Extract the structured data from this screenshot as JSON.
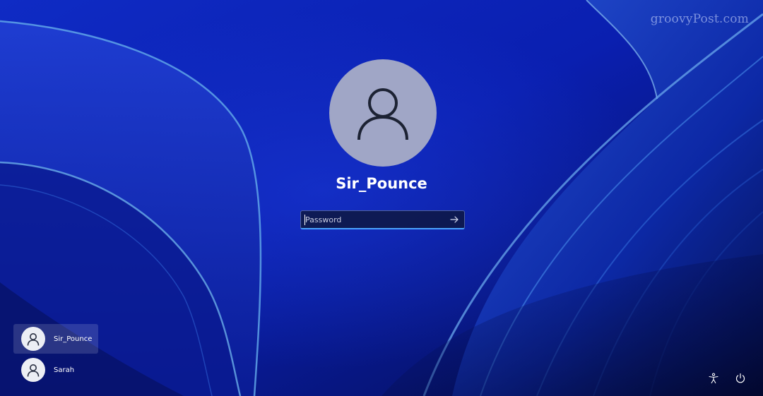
{
  "watermark": "groovyPost.com",
  "user": {
    "name": "Sir_Pounce",
    "avatar_icon": "person-icon"
  },
  "password": {
    "placeholder": "Password",
    "value": "",
    "submit_icon": "arrow-right-icon"
  },
  "users": [
    {
      "name": "Sir_Pounce",
      "selected": true,
      "icon": "person-icon"
    },
    {
      "name": "Sarah",
      "selected": false,
      "icon": "person-icon"
    }
  ],
  "system_buttons": {
    "accessibility_icon": "accessibility-icon",
    "power_icon": "power-icon"
  },
  "colors": {
    "wallpaper_base": "#0b1fb8",
    "avatar_background": "#a0a6c6",
    "input_focus": "#4aa3ff",
    "text": "#ffffff"
  }
}
